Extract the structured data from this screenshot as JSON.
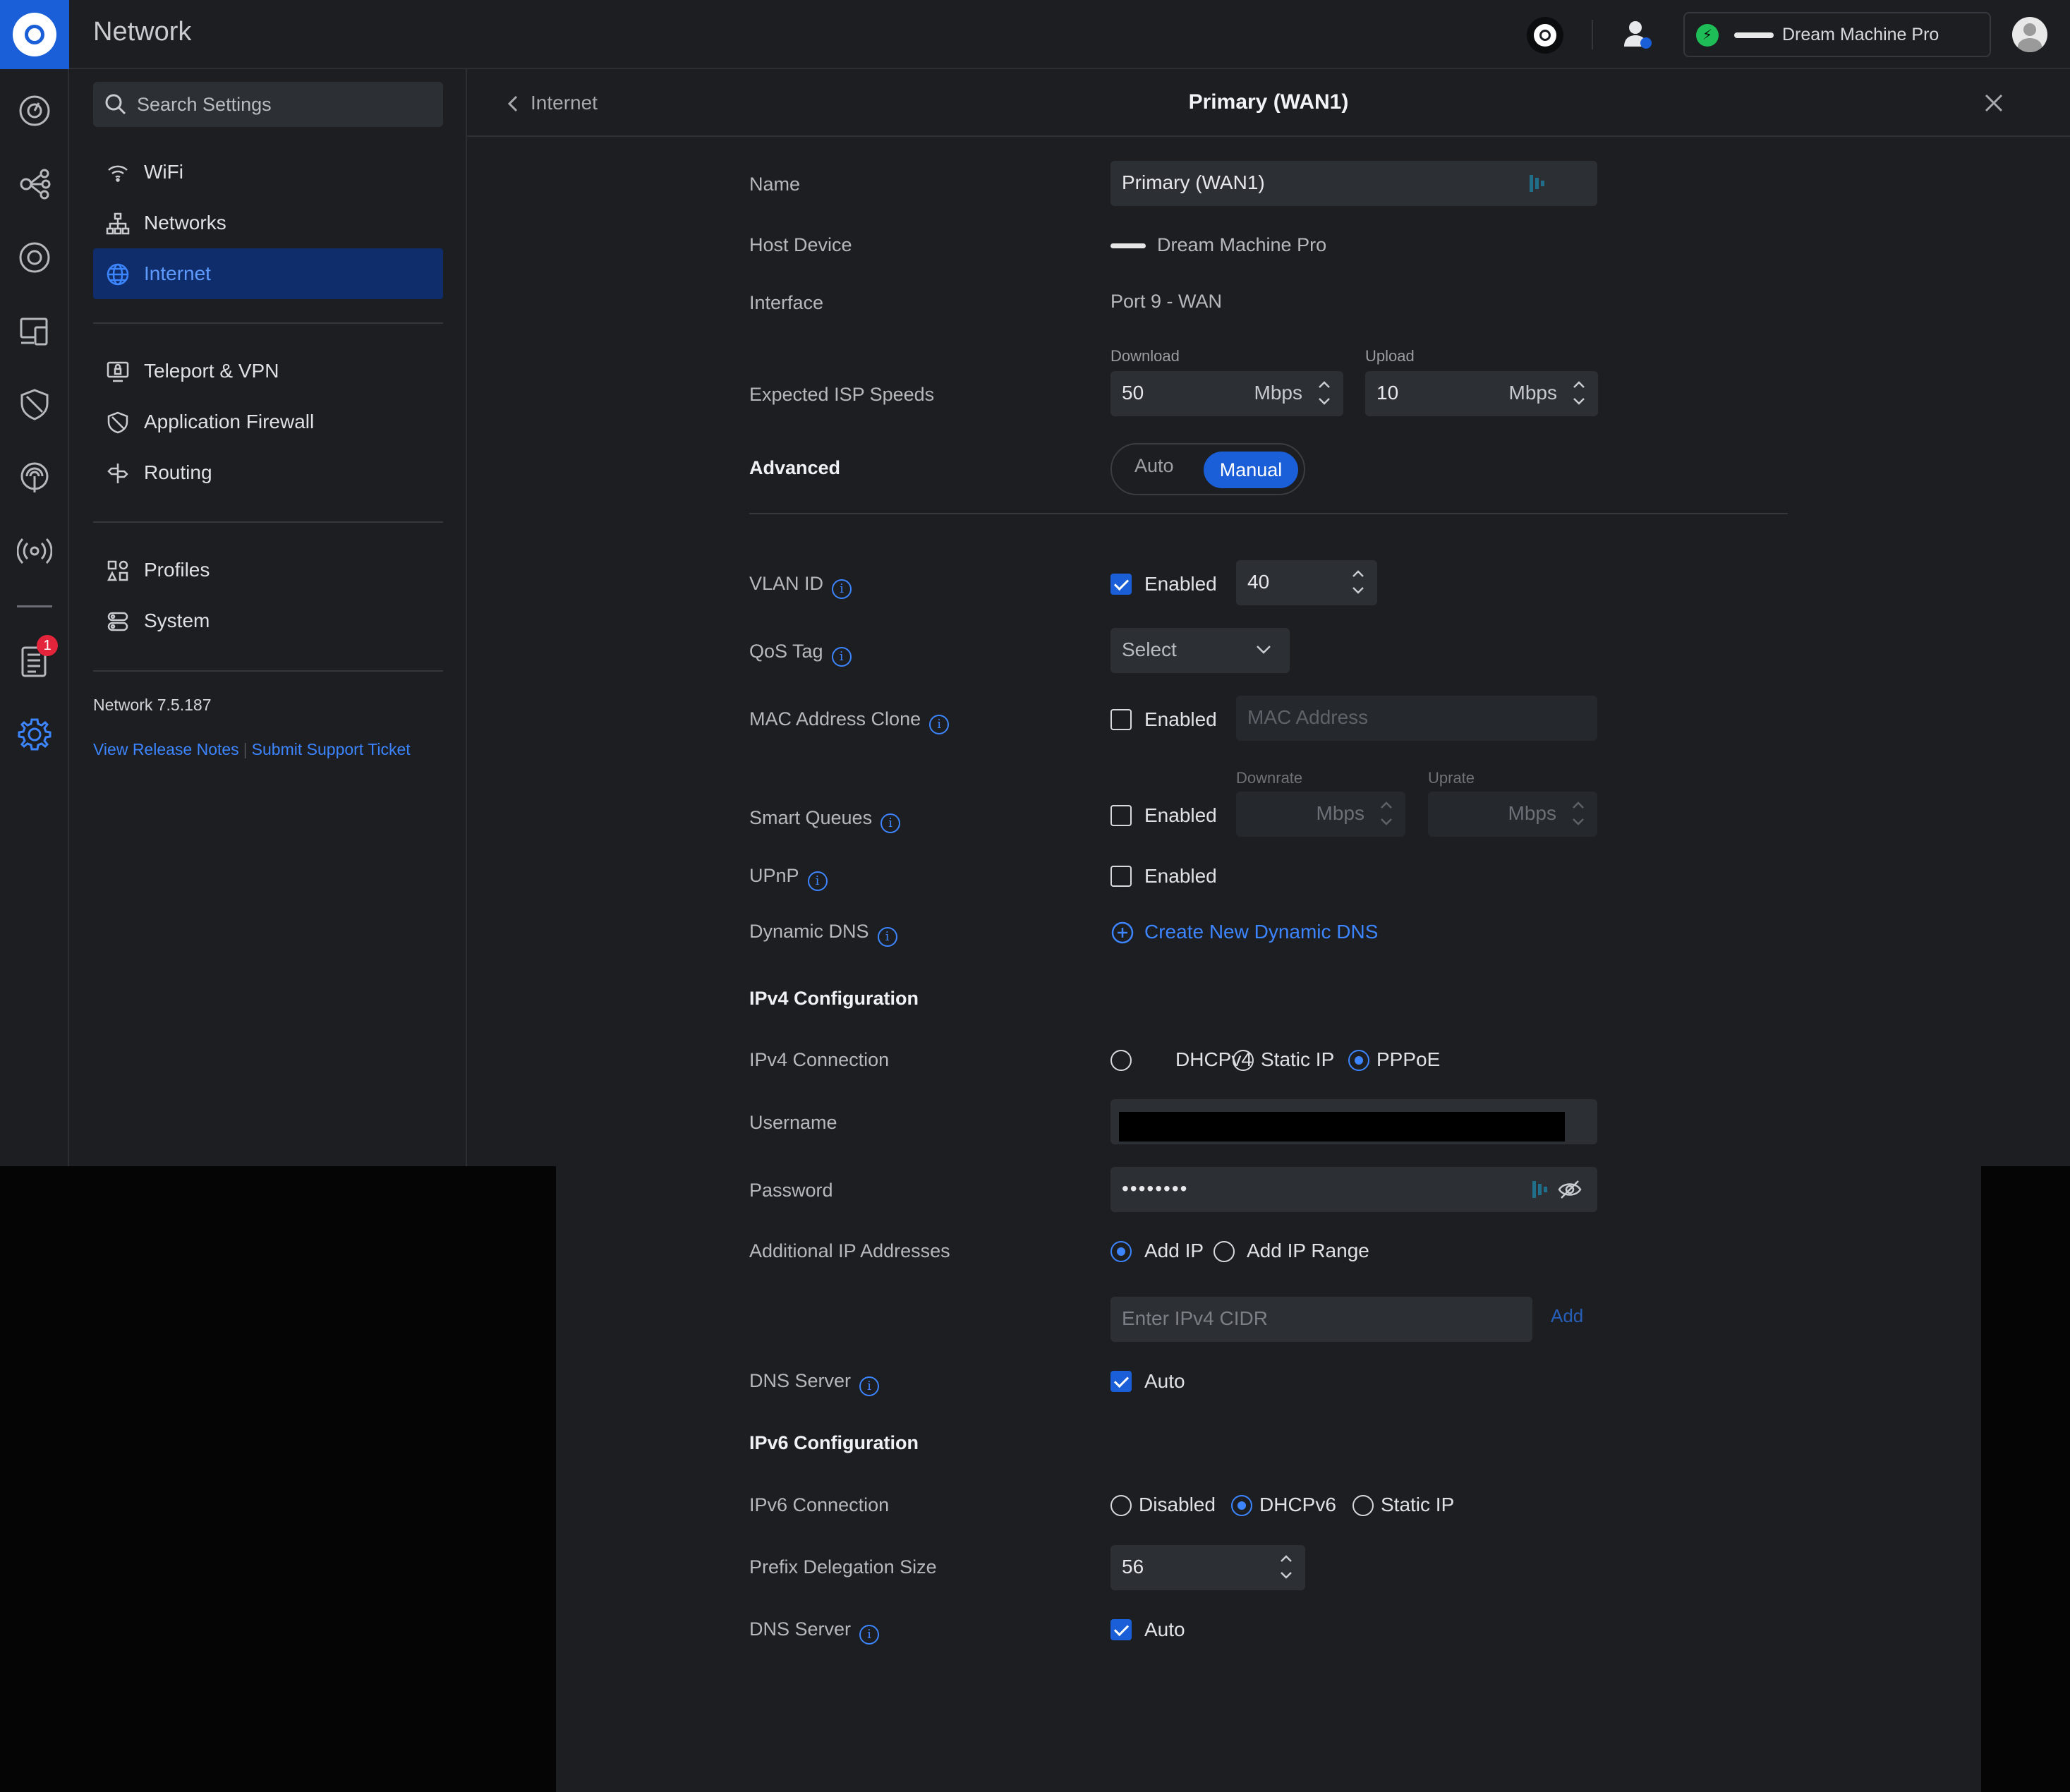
{
  "topbar": {
    "app_title": "Network",
    "device_name": "Dream Machine Pro"
  },
  "sidebar": {
    "search_placeholder": "Search Settings",
    "items": [
      {
        "label": "WiFi",
        "icon": "wifi-icon"
      },
      {
        "label": "Networks",
        "icon": "networks-icon"
      },
      {
        "label": "Internet",
        "icon": "globe-icon",
        "active": true
      },
      {
        "label": "Teleport & VPN",
        "icon": "vpn-icon"
      },
      {
        "label": "Application Firewall",
        "icon": "firewall-icon"
      },
      {
        "label": "Routing",
        "icon": "routing-icon"
      },
      {
        "label": "Profiles",
        "icon": "profiles-icon"
      },
      {
        "label": "System",
        "icon": "system-icon"
      }
    ],
    "version": "Network 7.5.187",
    "release_notes": "View Release Notes",
    "separator": "|",
    "support": "Submit Support Ticket"
  },
  "rail": {
    "notification_count": "1"
  },
  "header": {
    "back_label": "Internet",
    "title": "Primary (WAN1)"
  },
  "form": {
    "name": {
      "label": "Name",
      "value": "Primary (WAN1)"
    },
    "host_device": {
      "label": "Host Device",
      "value": "Dream Machine Pro"
    },
    "interface": {
      "label": "Interface",
      "value": "Port 9 - WAN"
    },
    "isp_speeds": {
      "label": "Expected ISP Speeds",
      "download_label": "Download",
      "download": "50",
      "upload_label": "Upload",
      "upload": "10",
      "unit": "Mbps"
    },
    "advanced": {
      "label": "Advanced",
      "options": [
        "Auto",
        "Manual"
      ],
      "selected": "Manual"
    },
    "vlan": {
      "label": "VLAN ID",
      "checked": true,
      "check_label": "Enabled",
      "value": "40"
    },
    "qos": {
      "label": "QoS Tag",
      "value": "Select"
    },
    "mac_clone": {
      "label": "MAC Address Clone",
      "checked": false,
      "check_label": "Enabled",
      "placeholder": "MAC Address"
    },
    "smart_queues": {
      "label": "Smart Queues",
      "checked": false,
      "check_label": "Enabled",
      "downrate_label": "Downrate",
      "uprate_label": "Uprate",
      "unit": "Mbps"
    },
    "upnp": {
      "label": "UPnP",
      "checked": false,
      "check_label": "Enabled"
    },
    "ddns": {
      "label": "Dynamic DNS",
      "action": "Create New Dynamic DNS"
    },
    "ipv4": {
      "heading": "IPv4 Configuration",
      "connection_label": "IPv4 Connection",
      "options": [
        "DHCPv4",
        "Static IP",
        "PPPoE"
      ],
      "selected": "PPPoE",
      "username_label": "Username",
      "password_label": "Password",
      "password_mask": "••••••••",
      "additional_label": "Additional IP Addresses",
      "additional_options": [
        "Add IP",
        "Add IP Range"
      ],
      "additional_selected": "Add IP",
      "cidr_placeholder": "Enter IPv4 CIDR",
      "add_label": "Add",
      "dns_label": "DNS Server",
      "dns_checked": true,
      "dns_value": "Auto"
    },
    "ipv6": {
      "heading": "IPv6 Configuration",
      "connection_label": "IPv6 Connection",
      "options": [
        "Disabled",
        "DHCPv6",
        "Static IP"
      ],
      "selected": "DHCPv6",
      "prefix_label": "Prefix Delegation Size",
      "prefix_value": "56",
      "dns_label": "DNS Server",
      "dns_checked": true,
      "dns_value": "Auto"
    }
  },
  "colors": {
    "accent": "#1a5fd8",
    "link": "#3d85ff",
    "panel": "#1c1e22",
    "field": "#2c2f34",
    "badge": "#e3243b",
    "online": "#1fbd57"
  }
}
